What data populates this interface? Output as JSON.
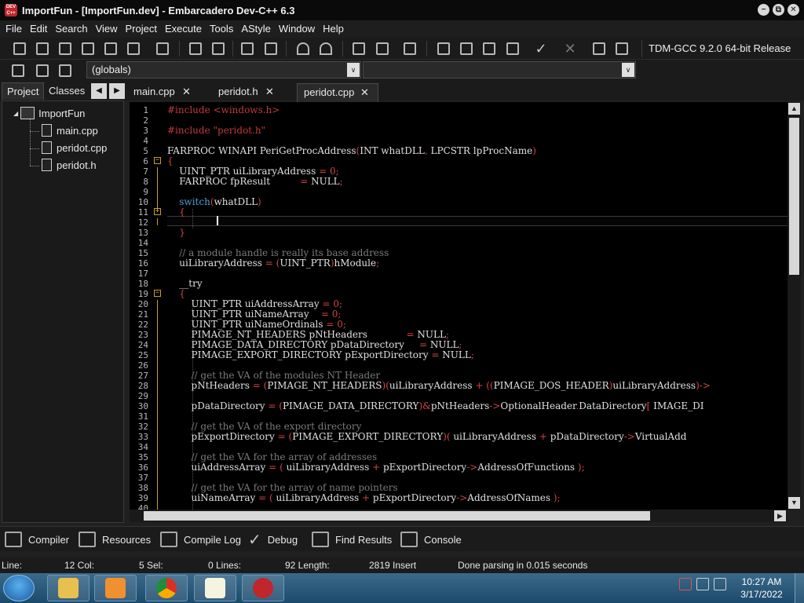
{
  "window": {
    "title": "ImportFun - [ImportFun.dev] - Embarcadero Dev-C++ 6.3",
    "app_icon_text": "DEV C++",
    "minimize": "−",
    "restore": "⧉",
    "close": "✕"
  },
  "menu": [
    "File",
    "Edit",
    "Search",
    "View",
    "Project",
    "Execute",
    "Tools",
    "AStyle",
    "Window",
    "Help"
  ],
  "toolbar": {
    "compiler": "TDM-GCC 9.2.0 64-bit Release",
    "scope": "(globals)",
    "combo_arrow": "∨"
  },
  "left_panel": {
    "tabs": [
      "Project",
      "Classes"
    ],
    "nav_prev": "◀",
    "nav_next": "▶",
    "project_name": "ImportFun",
    "files": [
      "main.cpp",
      "peridot.cpp",
      "peridot.h"
    ]
  },
  "editor_tabs": [
    {
      "label": "main.cpp",
      "close": "✕"
    },
    {
      "label": "peridot.h",
      "close": "✕"
    },
    {
      "label": "peridot.cpp",
      "close": "✕"
    }
  ],
  "editor": {
    "line_numbers": [
      "1",
      "2",
      "3",
      "4",
      "5",
      "6",
      "7",
      "8",
      "9",
      "10",
      "11",
      "12",
      "13",
      "14",
      "15",
      "16",
      "17",
      "18",
      "19",
      "20",
      "21",
      "22",
      "23",
      "24",
      "25",
      "26",
      "27",
      "28",
      "29",
      "30",
      "31",
      "32",
      "33",
      "34",
      "35",
      "36",
      "37",
      "38",
      "39",
      "40"
    ],
    "lines": [
      "#include <windows.h>",
      "",
      "#include \"peridot.h\"",
      "",
      "FARPROC WINAPI PeriGetProcAddress(INT whatDLL, LPCSTR lpProcName)",
      "{",
      "    UINT_PTR uiLibraryAddress = 0;",
      "    FARPROC fpResult          = NULL;",
      "",
      "    switch(whatDLL)",
      "    {",
      "",
      "    }",
      "",
      "    // a module handle is really its base address",
      "    uiLibraryAddress = (UINT_PTR)hModule;",
      "",
      "    __try",
      "    {",
      "        UINT_PTR uiAddressArray = 0;",
      "        UINT_PTR uiNameArray    = 0;",
      "        UINT_PTR uiNameOrdinals = 0;",
      "        PIMAGE_NT_HEADERS pNtHeaders             = NULL;",
      "        PIMAGE_DATA_DIRECTORY pDataDirectory     = NULL;",
      "        PIMAGE_EXPORT_DIRECTORY pExportDirectory = NULL;",
      "",
      "        // get the VA of the modules NT Header",
      "        pNtHeaders = (PIMAGE_NT_HEADERS)(uiLibraryAddress + ((PIMAGE_DOS_HEADER)uiLibraryAddress)->",
      "",
      "        pDataDirectory = (PIMAGE_DATA_DIRECTORY)&pNtHeaders->OptionalHeader.DataDirectory[ IMAGE_DI",
      "",
      "        // get the VA of the export directory",
      "        pExportDirectory = (PIMAGE_EXPORT_DIRECTORY)( uiLibraryAddress + pDataDirectory->VirtualAdd",
      "",
      "        // get the VA for the array of addresses",
      "        uiAddressArray = ( uiLibraryAddress + pExportDirectory->AddressOfFunctions );",
      "",
      "        // get the VA for the array of name pointers",
      "        uiNameArray = ( uiLibraryAddress + pExportDirectory->AddressOfNames );",
      ""
    ],
    "fold_marker": "−",
    "scroll_up": "▲",
    "scroll_down": "▼",
    "scroll_right": "▶"
  },
  "bottom_tabs": [
    "Compiler",
    "Resources",
    "Compile Log",
    "Debug",
    "Find Results",
    "Console"
  ],
  "status": {
    "line_label": "Line:",
    "col": "12 Col:",
    "sel": "5 Sel:",
    "lines": "0 Lines:",
    "length": "92 Length:",
    "insert": "2819 Insert",
    "message": "Done parsing in 0.015 seconds"
  },
  "taskbar": {
    "time": "10:27 AM",
    "date": "3/17/2022",
    "apps": [
      "file-explorer-icon",
      "media-player-icon",
      "chrome-icon",
      "notepad-icon",
      "devcpp-icon"
    ]
  },
  "colors": {
    "preprocessor": "#c23a3a",
    "keyword": "#4fa0d8",
    "number": "#d04545",
    "comment": "#7a7a7a"
  }
}
